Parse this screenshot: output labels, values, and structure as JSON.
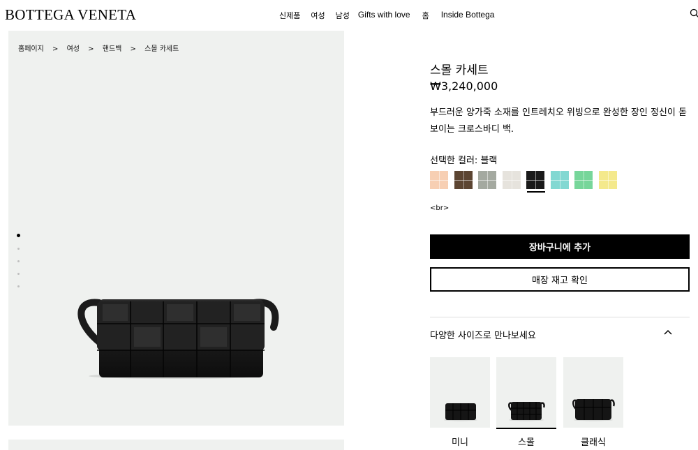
{
  "brand": {
    "logo": "BOTTEGA VENETA"
  },
  "nav": {
    "items": [
      "신제품",
      "여성",
      "남성",
      "Gifts with love",
      "홈",
      "Inside Bottega"
    ],
    "search_icon": "search-icon"
  },
  "breadcrumb": [
    "홈페이지",
    ">",
    "여성",
    ">",
    "핸드백",
    ">",
    "스몰 카세트"
  ],
  "gallery": {
    "slide_count": 5,
    "active_slide": 1
  },
  "product": {
    "title": "스몰 카세트",
    "price": "₩3,240,000",
    "description": "부드러운 양가죽 소재를 인트레치오 위빙으로 완성한 장인 정신이 돋보이는 크로스바디 백.",
    "color_label": "선택한 컬러: 블랙",
    "swatches": [
      {
        "color": "#f7cfb3",
        "selected": false
      },
      {
        "color": "#5c4532",
        "selected": false
      },
      {
        "color": "#a4a9a0",
        "selected": false
      },
      {
        "color": "#e6e3dd",
        "selected": false
      },
      {
        "color": "#1a1a1a",
        "selected": true
      },
      {
        "color": "#82d8d2",
        "selected": false
      },
      {
        "color": "#77d69a",
        "selected": false
      },
      {
        "color": "#f4e98c",
        "selected": false
      }
    ],
    "stray_text": "<br>",
    "add_to_cart": "장바구니에 추가",
    "check_store": "매장 재고 확인",
    "sizes_heading": "다양한 사이즈로 만나보세요",
    "sizes": [
      {
        "label": "미니",
        "selected": false
      },
      {
        "label": "스몰",
        "selected": true
      },
      {
        "label": "클래식",
        "selected": false
      }
    ]
  }
}
